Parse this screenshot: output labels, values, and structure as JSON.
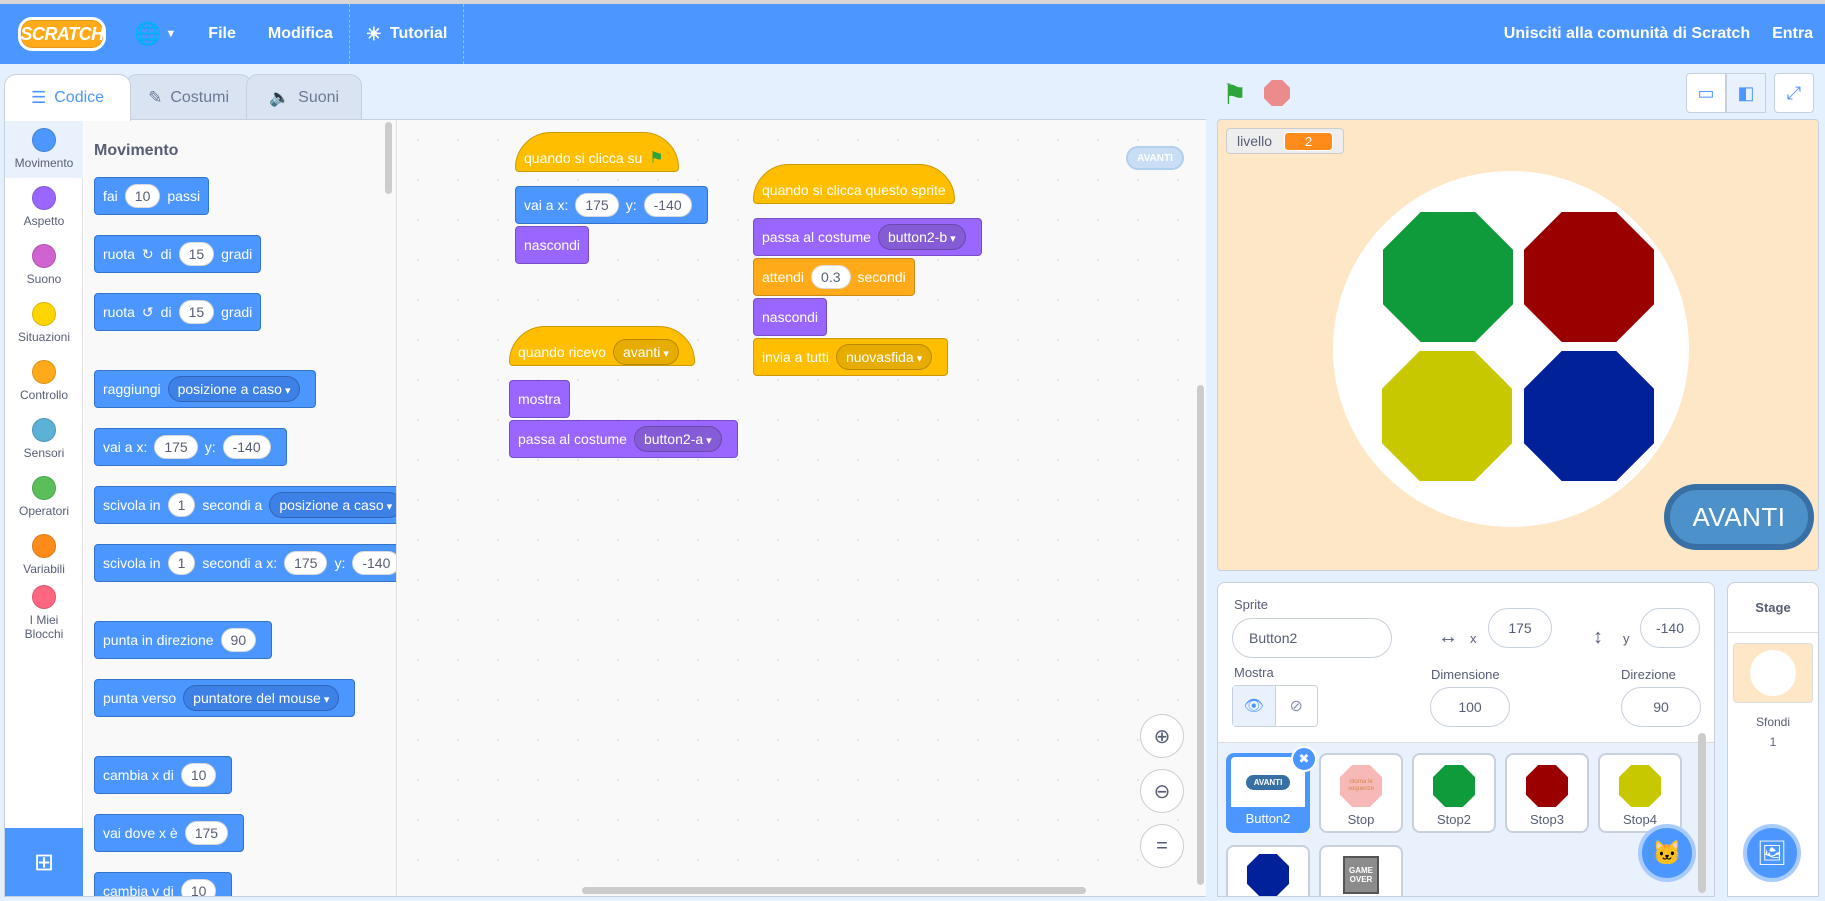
{
  "menu": {
    "logo": "SCRATCH",
    "file": "File",
    "edit": "Modifica",
    "tutorial": "Tutorial",
    "join": "Unisciti alla comunità di Scratch",
    "signin": "Entra"
  },
  "tabs": {
    "code": "Codice",
    "costumes": "Costumi",
    "sounds": "Suoni"
  },
  "categories": [
    {
      "label": "Movimento",
      "color": "#4c97ff"
    },
    {
      "label": "Aspetto",
      "color": "#9966ff"
    },
    {
      "label": "Suono",
      "color": "#cf63cf"
    },
    {
      "label": "Situazioni",
      "color": "#ffd500"
    },
    {
      "label": "Controllo",
      "color": "#ffab19"
    },
    {
      "label": "Sensori",
      "color": "#5cb1d6"
    },
    {
      "label": "Operatori",
      "color": "#59c059"
    },
    {
      "label": "Variabili",
      "color": "#ff8c1a"
    },
    {
      "label": "I Miei Blocchi",
      "color": "#ff6680"
    }
  ],
  "palette": {
    "title": "Movimento",
    "move": {
      "t1": "fai",
      "v": "10",
      "t2": "passi"
    },
    "turn_right": {
      "t1": "ruota",
      "t2": "di",
      "v": "15",
      "t3": "gradi"
    },
    "turn_left": {
      "t1": "ruota",
      "t2": "di",
      "v": "15",
      "t3": "gradi"
    },
    "goto": {
      "t1": "raggiungi",
      "dd": "posizione a caso"
    },
    "goto_xy": {
      "t1": "vai a x:",
      "x": "175",
      "t2": "y:",
      "y": "-140"
    },
    "glide_to": {
      "t1": "scivola in",
      "v": "1",
      "t2": "secondi a",
      "dd": "posizione a caso"
    },
    "glide_xy": {
      "t1": "scivola in",
      "v": "1",
      "t2": "secondi a x:",
      "x": "175",
      "t3": "y:",
      "y": "-140"
    },
    "point_dir": {
      "t1": "punta in direzione",
      "v": "90"
    },
    "point_towards": {
      "t1": "punta verso",
      "dd": "puntatore del mouse"
    },
    "change_x": {
      "t1": "cambia x di",
      "v": "10"
    },
    "set_x": {
      "t1": "vai dove x è",
      "v": "175"
    },
    "change_y": {
      "t1": "cambia y di",
      "v": "10"
    }
  },
  "scripts": {
    "s1": {
      "hat": "quando si clicca su",
      "goto_t1": "vai a x:",
      "x": "175",
      "goto_t2": "y:",
      "y": "-140",
      "hide": "nascondi"
    },
    "s2": {
      "hat": "quando si clicca questo sprite",
      "costume_t": "passa al costume",
      "costume": "button2-b",
      "wait_t1": "attendi",
      "wait_v": "0.3",
      "wait_t2": "secondi",
      "hide": "nascondi",
      "bcast_t": "invia a tutti",
      "bcast": "nuovasfida"
    },
    "s3": {
      "hat": "quando ricevo",
      "msg": "avanti",
      "show": "mostra",
      "costume_t": "passa al costume",
      "costume": "button2-a"
    }
  },
  "workspace": {
    "mini_avanti": "AVANTI"
  },
  "stage": {
    "monitor_label": "livello",
    "monitor_value": "2",
    "button": "AVANTI",
    "colors": {
      "green": "#0f9a3c",
      "red": "#9b0000",
      "yellow": "#c8c800",
      "blue": "#00219a"
    }
  },
  "sprite_info": {
    "sprite_label": "Sprite",
    "sprite_name": "Button2",
    "x_label": "x",
    "x": "175",
    "y_label": "y",
    "y": "-140",
    "show_label": "Mostra",
    "size_label": "Dimensione",
    "size": "100",
    "dir_label": "Direzione",
    "dir": "90"
  },
  "sprites": [
    {
      "name": "Button2",
      "thumb": "AVANTI"
    },
    {
      "name": "Stop",
      "thumb": "ritorna le sequenze"
    },
    {
      "name": "Stop2"
    },
    {
      "name": "Stop3"
    },
    {
      "name": "Stop4"
    },
    {
      "name": ""
    },
    {
      "name": "",
      "thumb": "GAME OVER"
    }
  ],
  "stage_pane": {
    "title": "Stage",
    "backdrops_label": "Sfondi",
    "backdrops_count": "1"
  }
}
